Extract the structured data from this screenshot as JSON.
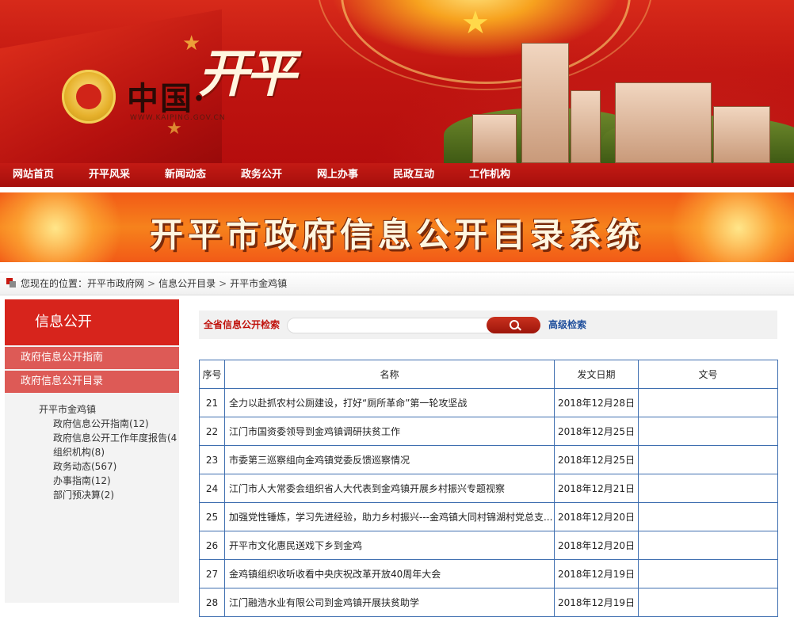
{
  "header": {
    "logo_prefix": "中国·",
    "logo_city": "开平",
    "logo_url": "WWW.KAIPING.GOV.CN"
  },
  "nav": {
    "items": [
      {
        "label": "网站首页"
      },
      {
        "label": "开平风采"
      },
      {
        "label": "新闻动态"
      },
      {
        "label": "政务公开"
      },
      {
        "label": "网上办事"
      },
      {
        "label": "民政互动"
      },
      {
        "label": "工作机构"
      }
    ]
  },
  "banner_title": "开平市政府信息公开目录系统",
  "breadcrumb": {
    "prefix": "您现在的位置：",
    "items": [
      "开平市政府网",
      "信息公开目录",
      "开平市金鸡镇"
    ],
    "separator": ">"
  },
  "sidebar": {
    "heading": "信息公开",
    "menu": [
      {
        "label": "政府信息公开指南"
      },
      {
        "label": "政府信息公开目录"
      }
    ],
    "tree": {
      "root": "开平市金鸡镇",
      "children": [
        {
          "label": "政府信息公开指南(12)"
        },
        {
          "label": "政府信息公开工作年度报告(4"
        },
        {
          "label": "组织机构(8)"
        },
        {
          "label": "政务动态(567)"
        },
        {
          "label": "办事指南(12)"
        },
        {
          "label": "部门预决算(2)"
        }
      ]
    }
  },
  "search": {
    "label": "全省信息公开检索",
    "value": "",
    "placeholder": "",
    "advanced_label": "高级检索"
  },
  "table": {
    "headers": [
      "序号",
      "名称",
      "发文日期",
      "文号"
    ],
    "rows": [
      {
        "idx": "21",
        "name": "全力以赴抓农村公厕建设，打好“厕所革命”第一轮攻坚战",
        "date": "2018年12月28日",
        "doc": ""
      },
      {
        "idx": "22",
        "name": "江门市国资委领导到金鸡镇调研扶贫工作",
        "date": "2018年12月25日",
        "doc": ""
      },
      {
        "idx": "23",
        "name": "市委第三巡察组向金鸡镇党委反馈巡察情况",
        "date": "2018年12月25日",
        "doc": ""
      },
      {
        "idx": "24",
        "name": "江门市人大常委会组织省人大代表到金鸡镇开展乡村振兴专题视察",
        "date": "2018年12月21日",
        "doc": ""
      },
      {
        "idx": "25",
        "name": "加强党性锤炼，学习先进经验，助力乡村振兴---金鸡镇大同村锦湖村党总支...",
        "date": "2018年12月20日",
        "doc": ""
      },
      {
        "idx": "26",
        "name": "开平市文化惠民送戏下乡到金鸡",
        "date": "2018年12月20日",
        "doc": ""
      },
      {
        "idx": "27",
        "name": "金鸡镇组织收听收看中央庆祝改革开放40周年大会",
        "date": "2018年12月19日",
        "doc": ""
      },
      {
        "idx": "28",
        "name": "江门融浩水业有限公司到金鸡镇开展扶贫助学",
        "date": "2018年12月19日",
        "doc": ""
      }
    ]
  },
  "colors": {
    "brand_red": "#c41a14",
    "link_blue": "#1f4f9c",
    "table_border": "#3f6fb0"
  }
}
